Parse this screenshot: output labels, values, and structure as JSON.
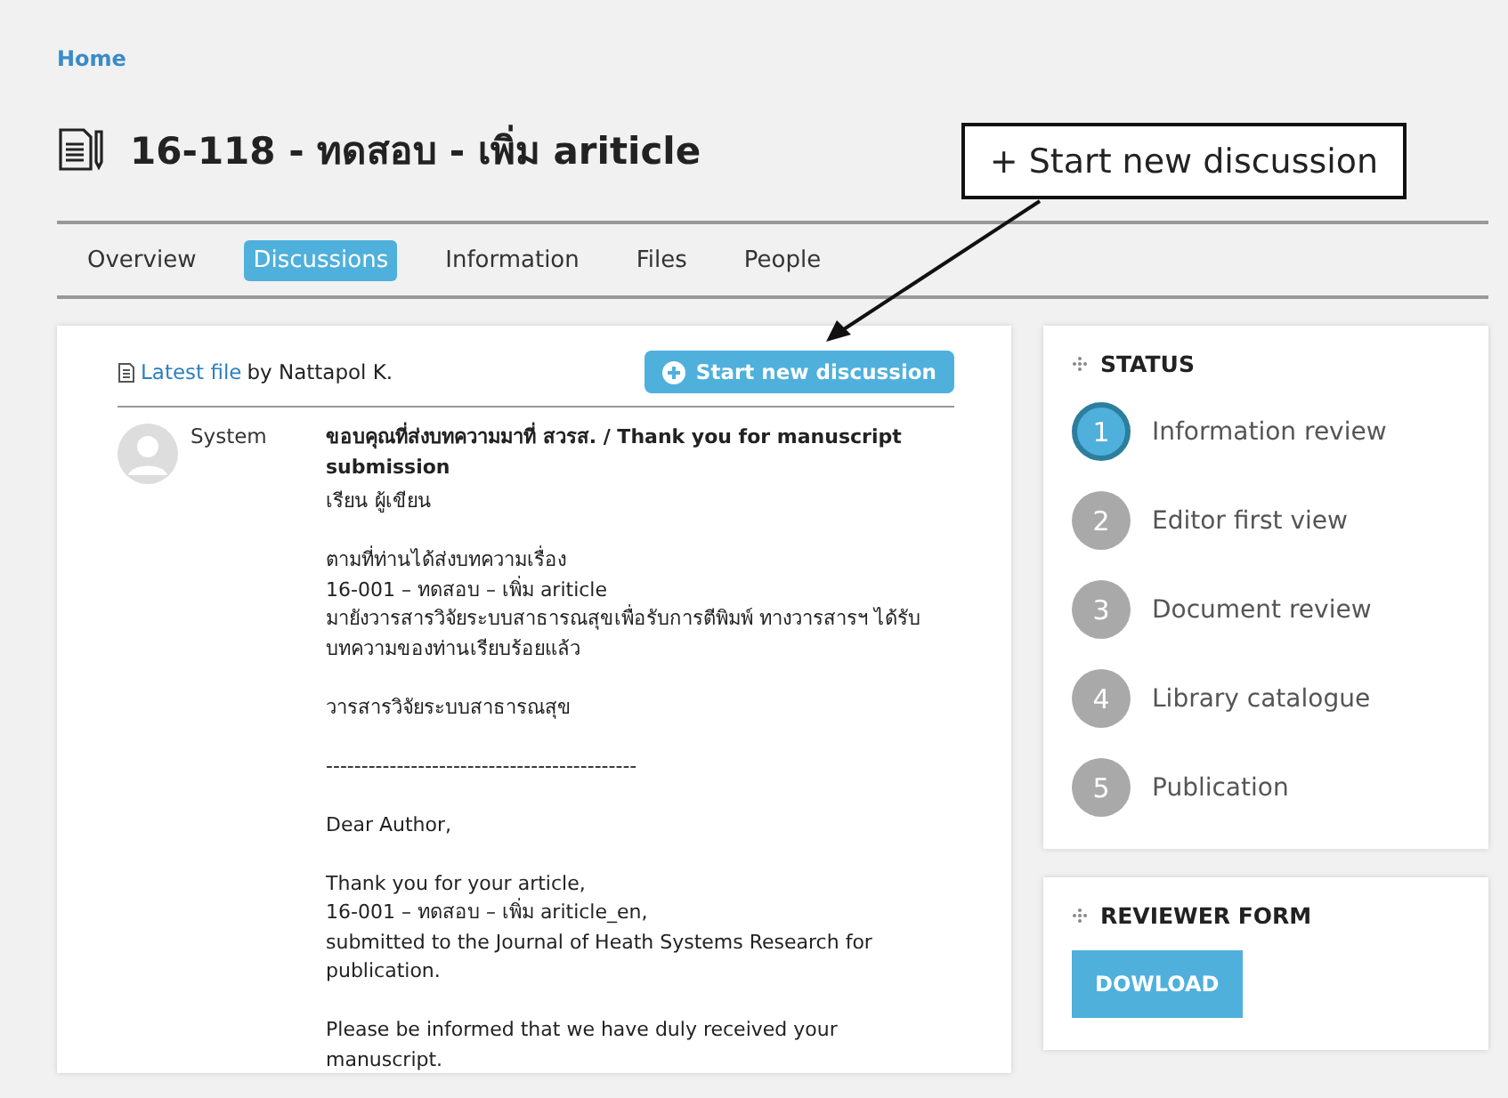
{
  "breadcrumb": "Home",
  "title": "16-118 - ทดสอบ - เพิ่ม ariticle",
  "callout": "+ Start new discussion",
  "tabs": [
    {
      "label": "Overview",
      "selected": false
    },
    {
      "label": "Discussions",
      "selected": true
    },
    {
      "label": "Information",
      "selected": false
    },
    {
      "label": "Files",
      "selected": false
    },
    {
      "label": "People",
      "selected": false
    }
  ],
  "latest_file": {
    "link": "Latest file",
    "by": "by Nattapol K."
  },
  "new_discussion_button": "Start new discussion",
  "message": {
    "author": "System",
    "subject": "ขอบคุณที่ส่งบทความมาที่ สวรส. / Thank you for manuscript submission",
    "paragraphs": [
      [
        "เรียน ผู้เขียน"
      ],
      [
        "ตามที่ท่านได้ส่งบทความเรื่อง",
        "16-001 – ทดสอบ – เพิ่ม ariticle",
        "มายังวารสารวิจัยระบบสาธารณสุขเพื่อรับการตีพิมพ์ ทางวารสารฯ ได้รับบทความของท่านเรียบร้อยแล้ว"
      ],
      [
        "วารสารวิจัยระบบสาธารณสุข"
      ],
      [
        "--------------------------------------------"
      ],
      [
        "Dear Author,"
      ],
      [
        "Thank you for your article,",
        "16-001 – ทดสอบ – เพิ่ม ariticle_en,",
        "submitted to the Journal of Heath Systems Research for publication."
      ],
      [
        "Please be informed that we have duly received your manuscript."
      ]
    ]
  },
  "status": {
    "heading": "STATUS",
    "steps": [
      {
        "number": "1",
        "label": "Information review",
        "current": true
      },
      {
        "number": "2",
        "label": "Editor first view",
        "current": false
      },
      {
        "number": "3",
        "label": "Document review",
        "current": false
      },
      {
        "number": "4",
        "label": "Library catalogue",
        "current": false
      },
      {
        "number": "5",
        "label": "Publication",
        "current": false
      }
    ]
  },
  "reviewer_form": {
    "heading": "REVIEWER FORM",
    "button": "DOWLOAD"
  }
}
